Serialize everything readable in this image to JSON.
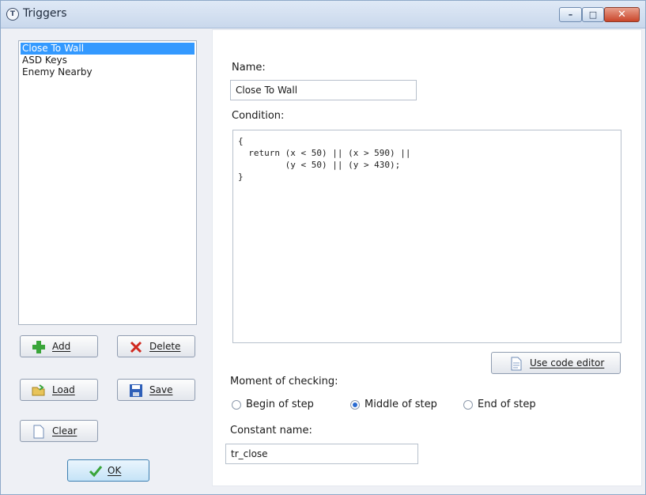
{
  "window": {
    "title": "Triggers"
  },
  "triggers": {
    "items": [
      "Close To Wall",
      "ASD Keys",
      "Enemy Nearby"
    ],
    "selected_index": 0
  },
  "buttons": {
    "add": "Add",
    "delete": "Delete",
    "load": "Load",
    "save": "Save",
    "clear": "Clear",
    "ok": "OK",
    "use_code_editor": "Use code editor"
  },
  "form": {
    "name_label": "Name:",
    "name_value": "Close To Wall",
    "condition_label": "Condition:",
    "condition_code": "{\n  return (x < 50) || (x > 590) ||\n         (y < 50) || (y > 430);\n}",
    "moment_label": "Moment of checking:",
    "moment_options": [
      "Begin of step",
      "Middle of step",
      "End of step"
    ],
    "moment_selected": "Middle of step",
    "constant_label": "Constant name:",
    "constant_value": "tr_close"
  },
  "colors": {
    "selection": "#3399ff",
    "accent": "#2a6bd1"
  }
}
